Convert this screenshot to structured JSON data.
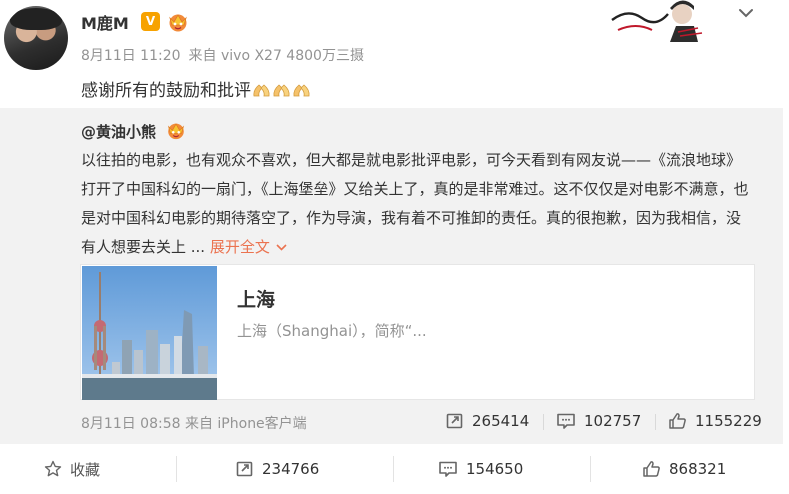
{
  "post": {
    "username": "M鹿M",
    "verified_badge": "V",
    "meta_date": "8月11日 11:20",
    "meta_source": "来自 vivo X27 4800万三摄",
    "text": "感谢所有的鼓励和批评",
    "emoji": "pray-hands-emoji"
  },
  "repost": {
    "username": "@黄油小熊",
    "text": "以往拍的电影，也有观众不喜欢，但大都是就电影批评电影，可今天看到有网友说——《流浪地球》打开了中国科幻的一扇门，《上海堡垒》又给关上了，真的是非常难过。这不仅仅是对电影不满意，也是对中国科幻电影的期待落空了，作为导演，我有着不可推卸的责任。真的很抱歉，因为我相信，没有人想要去关上 ...",
    "expand_label": "展开全文",
    "card": {
      "title": "上海",
      "description": "上海（Shanghai），简称“..."
    },
    "footer_time": "8月11日 08:58 来自 iPhone客户端",
    "stats": {
      "reposts": "265414",
      "comments": "102757",
      "likes": "1155229"
    }
  },
  "footer": {
    "favorite_label": "收藏",
    "reposts": "234766",
    "comments": "154650",
    "likes": "868321"
  },
  "colors": {
    "accent_orange": "#eb7350",
    "verified_gold": "#f7a200",
    "repost_bg": "#f2f2f2",
    "muted_text": "#939393"
  },
  "icons": [
    "avatar",
    "verified-v-icon",
    "crown-badge-icon",
    "chevron-down-icon",
    "repost-icon",
    "comment-icon",
    "like-icon",
    "star-icon"
  ]
}
